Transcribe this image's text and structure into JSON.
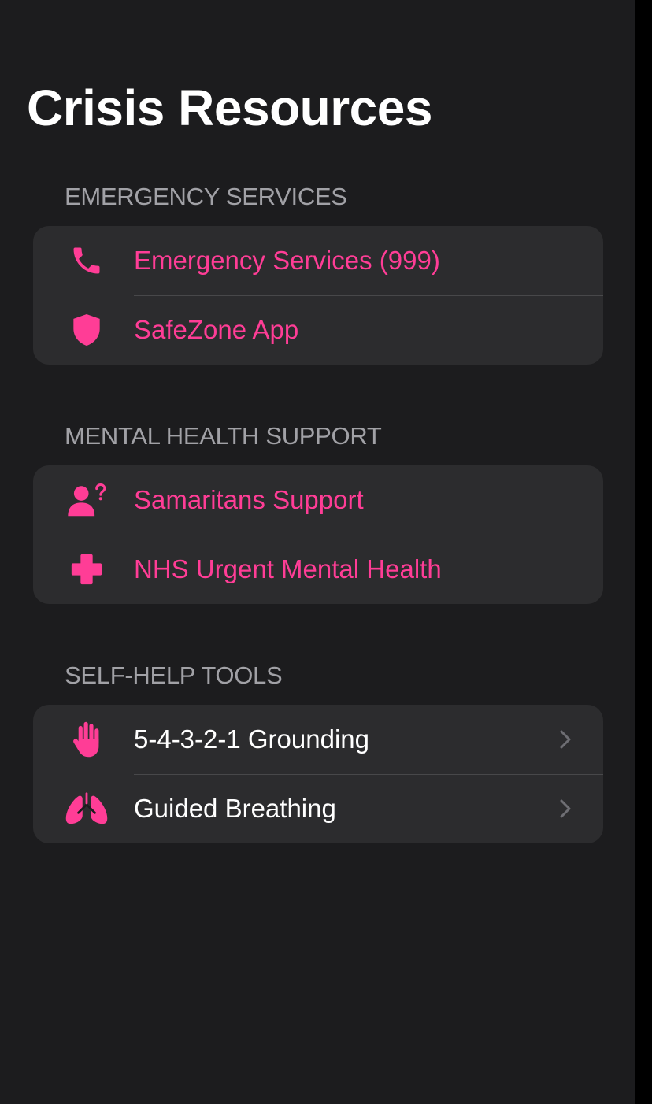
{
  "title": "Crisis Resources",
  "accent_color": "#ff3d96",
  "sections": [
    {
      "header": "EMERGENCY SERVICES",
      "items": [
        {
          "label": "Emergency Services (999)",
          "icon": "phone-icon"
        },
        {
          "label": "SafeZone App",
          "icon": "shield-icon"
        }
      ]
    },
    {
      "header": "MENTAL HEALTH SUPPORT",
      "items": [
        {
          "label": "Samaritans Support",
          "icon": "person-question-icon"
        },
        {
          "label": "NHS Urgent Mental Health",
          "icon": "medical-cross-icon"
        }
      ]
    },
    {
      "header": "SELF-HELP TOOLS",
      "items": [
        {
          "label": "5-4-3-2-1 Grounding",
          "icon": "hand-icon"
        },
        {
          "label": "Guided Breathing",
          "icon": "lungs-icon"
        }
      ]
    }
  ]
}
